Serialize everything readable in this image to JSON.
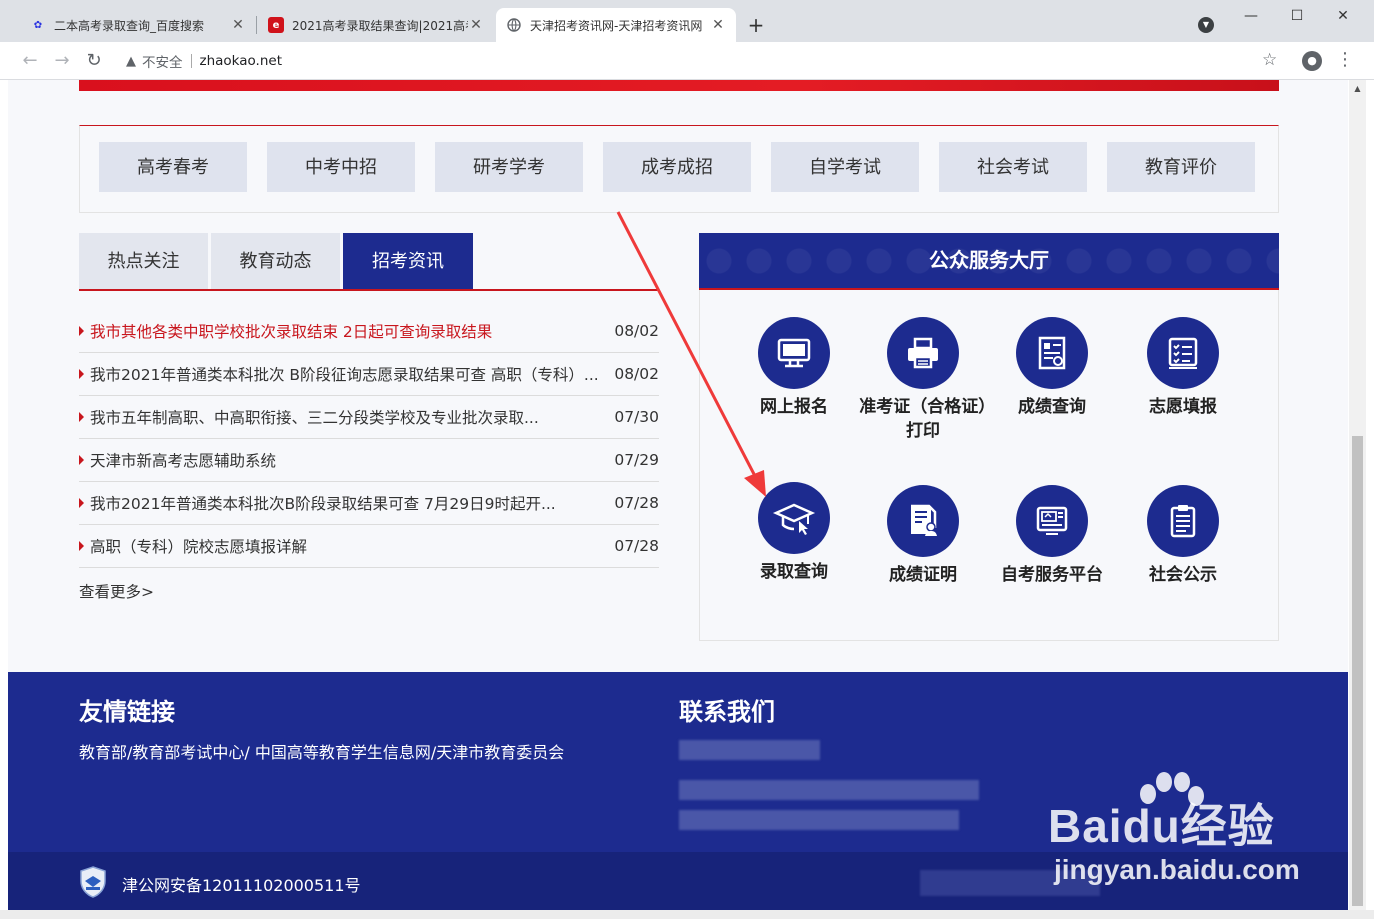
{
  "browser": {
    "tabs": [
      {
        "title": "二本高考录取查询_百度搜索",
        "favicon": "baidu-paw-icon",
        "active": false
      },
      {
        "title": "2021高考录取结果查询|2021高考",
        "favicon": "eol-logo-icon",
        "active": false
      },
      {
        "title": "天津招考资讯网-天津招考资讯网",
        "favicon": "globe-icon",
        "active": true
      }
    ],
    "address": {
      "security_label": "不安全",
      "url": "zhaokao.net"
    }
  },
  "categories": [
    "高考春考",
    "中考中招",
    "研考学考",
    "成考成招",
    "自学考试",
    "社会考试",
    "教育评价"
  ],
  "news": {
    "tabs": [
      "热点关注",
      "教育动态",
      "招考资讯"
    ],
    "active_tab": "招考资讯",
    "items": [
      {
        "title": "我市其他各类中职学校批次录取结束 2日起可查询录取结果",
        "date": "08/02",
        "highlight": true
      },
      {
        "title": "我市2021年普通类本科批次 B阶段征询志愿录取结果可查 高职（专科）...",
        "date": "08/02",
        "highlight": false
      },
      {
        "title": "我市五年制高职、中高职衔接、三二分段类学校及专业批次录取...",
        "date": "07/30",
        "highlight": false
      },
      {
        "title": "天津市新高考志愿辅助系统",
        "date": "07/29",
        "highlight": false
      },
      {
        "title": "我市2021年普通类本科批次B阶段录取结果可查 7月29日9时起开...",
        "date": "07/28",
        "highlight": false
      },
      {
        "title": "高职（专科）院校志愿填报详解",
        "date": "07/28",
        "highlight": false
      }
    ],
    "more": "查看更多>"
  },
  "service_hall": {
    "title": "公众服务大厅",
    "items": [
      {
        "label": "网上报名",
        "icon": "monitor-icon"
      },
      {
        "label": "准考证（合格证）打印",
        "icon": "printer-icon"
      },
      {
        "label": "成绩查询",
        "icon": "score-report-icon"
      },
      {
        "label": "志愿填报",
        "icon": "checklist-icon"
      },
      {
        "label": "录取查询",
        "icon": "graduation-cap-icon"
      },
      {
        "label": "成绩证明",
        "icon": "certificate-icon"
      },
      {
        "label": "自考服务平台",
        "icon": "self-study-platform-icon"
      },
      {
        "label": "社会公示",
        "icon": "clipboard-icon"
      }
    ]
  },
  "footer": {
    "links_heading": "友情链接",
    "links_text": "教育部/教育部考试中心/ 中国高等教育学生信息网/天津市教育委员会",
    "contact_heading": "联系我们",
    "icp": "津公网安备12011102000511号"
  },
  "watermark": {
    "brand": "Baidu经验",
    "url": "jingyan.baidu.com"
  },
  "colors": {
    "brand_navy": "#1d2b8f",
    "accent_red": "#c8161d",
    "category_bg": "#dfe3ee"
  }
}
